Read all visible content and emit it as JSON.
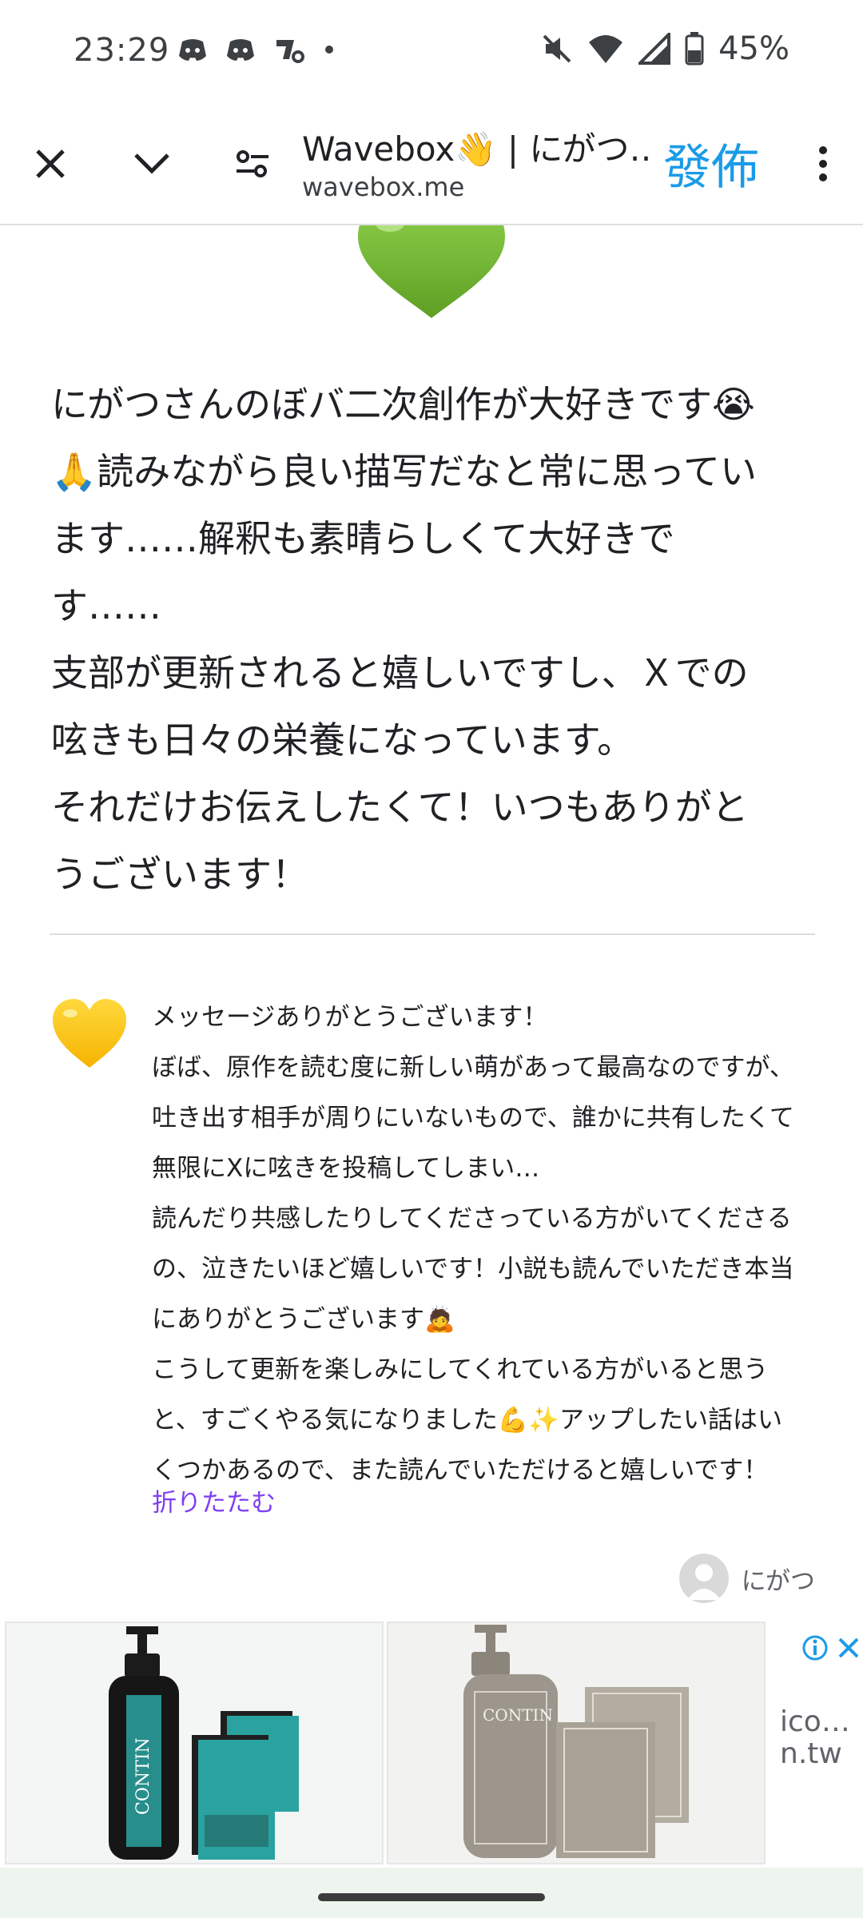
{
  "status_bar": {
    "time": "23:29",
    "battery_percent": "45%",
    "icons_left": [
      "discord-icon",
      "discord-icon",
      "app-icon",
      "dot-icon"
    ],
    "icons_right": [
      "mute-icon",
      "wifi-icon",
      "signal-icon",
      "battery-icon"
    ]
  },
  "toolbar": {
    "page_title": "Wavebox👋 | にがつ…",
    "page_url": "wavebox.me",
    "publish_label": "發佈"
  },
  "content": {
    "message_text": "にがつさんのぼバ二次創作が大好きです😭\n🙏読みながら良い描写だなと常に思ってい\nます……解釈も素晴らしくて大好きで\nす……\n支部が更新されると嬉しいですし、Ｘでの\n呟きも日々の栄養になっています。\nそれだけお伝えしたくて！いつもありがと\nうございます！",
    "reply_text": "メッセージありがとうございます！\nぼば、原作を読む度に新しい萌があって最高なのですが、\n吐き出す相手が周りにいないもので、誰かに共有したくて\n無限にXに呟きを投稿してしまい…\n読んだり共感したりしてくださっている方がいてくださる\nの、泣きたいほど嬉しいです！小説も読んでいただき本当\nにありがとうございます🙇\nこうして更新を楽しみにしてくれている方がいると思う\nと、すごくやる気になりました💪✨アップしたい話はい\nくつかあるので、また読んでいただけると嬉しいです！",
    "collapse_label": "折りたたむ",
    "author_name": "にがつ"
  },
  "ad": {
    "domain_text": "ico…\nn.tw",
    "brand_1": "CONTIN",
    "brand_2": "CONTIN",
    "accent_color": "#2aa3a0"
  }
}
